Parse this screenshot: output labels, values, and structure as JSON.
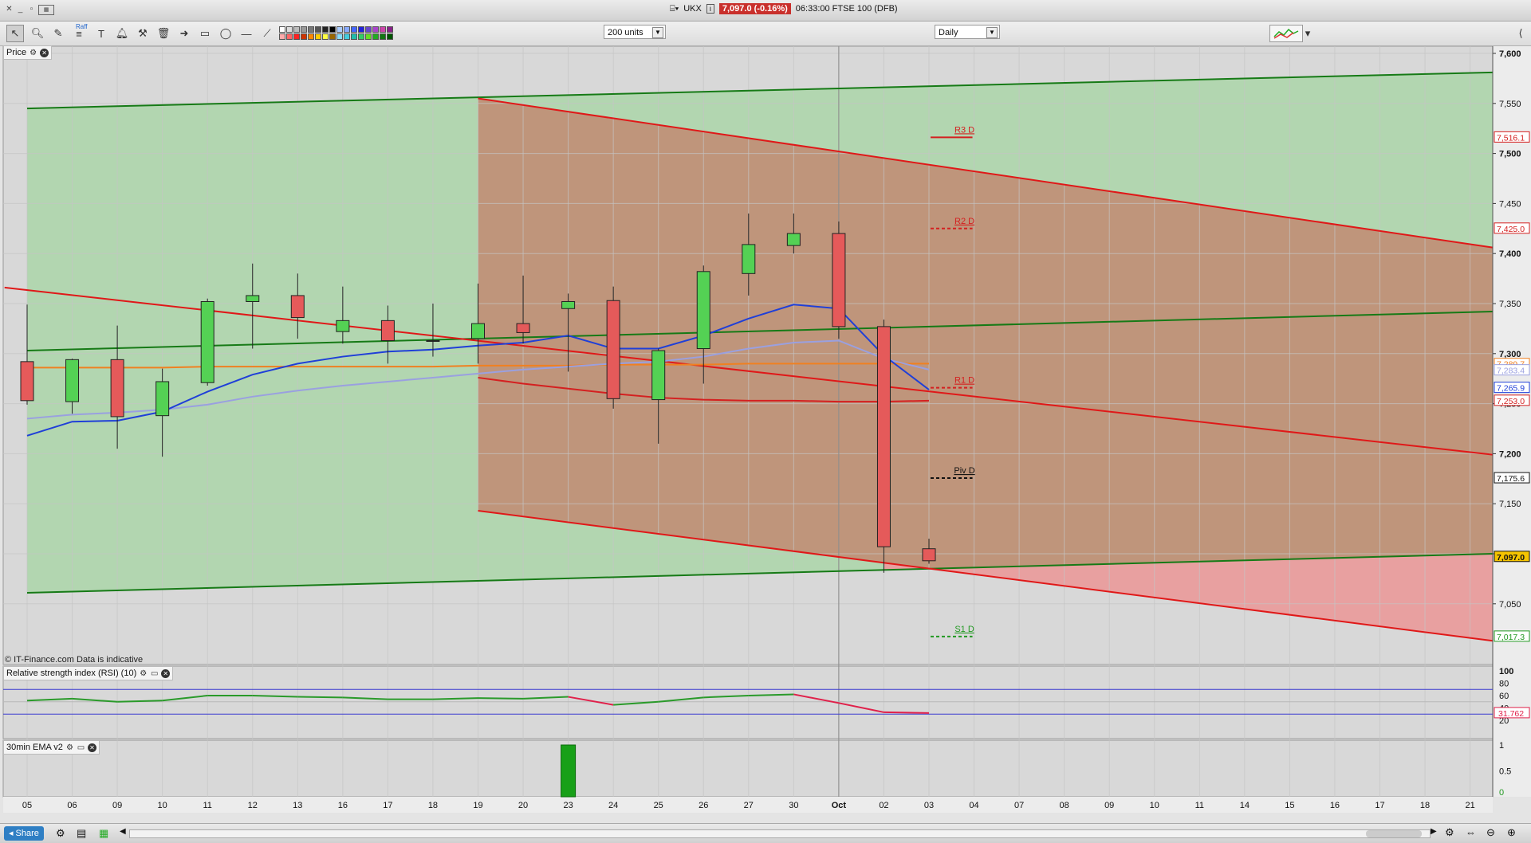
{
  "window": {
    "title_icon": "briefcase-icon",
    "symbol": "UKX",
    "info_icon": "info-icon",
    "last_price": "7,097.0 (-0.16%)",
    "time_instrument": "06:33:00 FTSE 100 (DFB)"
  },
  "toolbar": {
    "units": "200 units",
    "interval": "Daily",
    "fib_label": "Raff"
  },
  "panels": {
    "price": {
      "label": "Price"
    },
    "rsi": {
      "label": "Relative strength index (RSI) (10)"
    },
    "ema": {
      "label": "30min EMA v2"
    }
  },
  "copyright": "© IT-Finance.com  Data is indicative",
  "price_axis": {
    "ticks": [
      "7,600",
      "7,550",
      "7,500",
      "7,450",
      "7,400",
      "7,350",
      "7,300",
      "7,250",
      "7,200",
      "7,150",
      "7,100",
      "7,050"
    ],
    "tick_values": [
      7600,
      7550,
      7500,
      7450,
      7400,
      7350,
      7300,
      7250,
      7200,
      7150,
      7100,
      7050
    ],
    "tags": [
      {
        "text": "7,516.1",
        "value": 7516.1,
        "bg": "#ffffff",
        "fg": "#d42020"
      },
      {
        "text": "7,425.0",
        "value": 7425.0,
        "bg": "#ffffff",
        "fg": "#d42020"
      },
      {
        "text": "7,289.7",
        "value": 7289.7,
        "bg": "#ffffff",
        "fg": "#f08020"
      },
      {
        "text": "7,283.4",
        "value": 7283.4,
        "bg": "#ffffff",
        "fg": "#9aa0e0"
      },
      {
        "text": "7,265.9",
        "value": 7265.9,
        "bg": "#ffffff",
        "fg": "#1f3fd8"
      },
      {
        "text": "7,253.0",
        "value": 7253.0,
        "bg": "#ffffff",
        "fg": "#d42020"
      },
      {
        "text": "7,175.6",
        "value": 7175.6,
        "bg": "#ffffff",
        "fg": "#111111"
      },
      {
        "text": "7,097.0",
        "value": 7097.0,
        "bg": "#f5c400",
        "fg": "#111111"
      },
      {
        "text": "7,017.3",
        "value": 7017.3,
        "bg": "#ffffff",
        "fg": "#229922"
      }
    ]
  },
  "pivots": [
    {
      "label": "R3 D",
      "value": 7516.1,
      "color": "#d42020",
      "dashed": false
    },
    {
      "label": "R2 D",
      "value": 7425.0,
      "color": "#d42020",
      "dashed": true
    },
    {
      "label": "R1 D",
      "value": 7265.9,
      "color": "#d42020",
      "dashed": true
    },
    {
      "label": "Piv D",
      "value": 7175.6,
      "color": "#111111",
      "dashed": true
    },
    {
      "label": "S1 D",
      "value": 7017.3,
      "color": "#229922",
      "dashed": true
    }
  ],
  "rsi_axis": {
    "ticks": [
      "100",
      "80",
      "60",
      "40",
      "20"
    ],
    "tick_values": [
      100,
      80,
      60,
      40,
      20
    ],
    "value_tag": "31.762",
    "value": 31.762
  },
  "ema_axis": {
    "ticks": [
      "1",
      "0.5",
      "0"
    ],
    "tick_values": [
      1,
      0.5,
      0
    ]
  },
  "chart_data": {
    "type": "candlestick",
    "title": "",
    "dates": [
      "05",
      "06",
      "09",
      "10",
      "11",
      "12",
      "13",
      "16",
      "17",
      "18",
      "19",
      "20",
      "23",
      "24",
      "25",
      "26",
      "27",
      "30",
      "Oct",
      "02",
      "03",
      "04",
      "07",
      "08",
      "09",
      "10",
      "11",
      "14",
      "15",
      "16",
      "17",
      "18",
      "21"
    ],
    "candles": [
      {
        "date": "05",
        "open": 7292,
        "high": 7349,
        "low": 7249,
        "close": 7253
      },
      {
        "date": "06",
        "open": 7252,
        "high": 7295,
        "low": 7240,
        "close": 7294
      },
      {
        "date": "09",
        "open": 7294,
        "high": 7328,
        "low": 7205,
        "close": 7237
      },
      {
        "date": "10",
        "open": 7238,
        "high": 7285,
        "low": 7197,
        "close": 7272
      },
      {
        "date": "11",
        "open": 7271,
        "high": 7355,
        "low": 7268,
        "close": 7352
      },
      {
        "date": "12",
        "open": 7352,
        "high": 7390,
        "low": 7305,
        "close": 7358
      },
      {
        "date": "13",
        "open": 7358,
        "high": 7380,
        "low": 7315,
        "close": 7336
      },
      {
        "date": "16",
        "open": 7322,
        "high": 7367,
        "low": 7310,
        "close": 7333
      },
      {
        "date": "17",
        "open": 7333,
        "high": 7348,
        "low": 7290,
        "close": 7313
      },
      {
        "date": "18",
        "open": 7313,
        "high": 7350,
        "low": 7297,
        "close": 7313
      },
      {
        "date": "19",
        "open": 7315,
        "high": 7370,
        "low": 7290,
        "close": 7330
      },
      {
        "date": "20",
        "open": 7330,
        "high": 7378,
        "low": 7310,
        "close": 7321
      },
      {
        "date": "23",
        "open": 7345,
        "high": 7360,
        "low": 7282,
        "close": 7352
      },
      {
        "date": "24",
        "open": 7353,
        "high": 7367,
        "low": 7245,
        "close": 7255
      },
      {
        "date": "25",
        "open": 7254,
        "high": 7305,
        "low": 7210,
        "close": 7303
      },
      {
        "date": "26",
        "open": 7305,
        "high": 7388,
        "low": 7270,
        "close": 7382
      },
      {
        "date": "27",
        "open": 7380,
        "high": 7440,
        "low": 7358,
        "close": 7409
      },
      {
        "date": "30",
        "open": 7408,
        "high": 7440,
        "low": 7400,
        "close": 7420
      },
      {
        "date": "Oct",
        "open": 7420,
        "high": 7432,
        "low": 7315,
        "close": 7327
      },
      {
        "date": "02",
        "open": 7327,
        "high": 7334,
        "low": 7081,
        "close": 7107
      },
      {
        "date": "03",
        "open": 7105,
        "high": 7115,
        "low": 7090,
        "close": 7093
      }
    ],
    "ma_fast": {
      "color": "#1f3fd8",
      "values": [
        7218,
        7232,
        7233,
        7242,
        7262,
        7279,
        7290,
        7297,
        7302,
        7304,
        7308,
        7311,
        7318,
        7305,
        7305,
        7318,
        7335,
        7349,
        7345,
        7298,
        7264
      ]
    },
    "ma_mid": {
      "color": "#9aa0e0",
      "values": [
        7235,
        7239,
        7241,
        7244,
        7249,
        7257,
        7263,
        7268,
        7272,
        7276,
        7280,
        7284,
        7287,
        7290,
        7292,
        7297,
        7305,
        7311,
        7313,
        7295,
        7284
      ]
    },
    "ma_slow": {
      "color": "#f08020",
      "values": [
        7286,
        7286,
        7286,
        7286,
        7287,
        7287,
        7287,
        7287,
        7287,
        7287,
        7288,
        7288,
        7288,
        7289,
        7289,
        7289,
        7290,
        7290,
        7290,
        7290,
        7290
      ]
    },
    "ma_red": {
      "color": "#d42020",
      "from_index": 10,
      "values": [
        7276,
        7270,
        7265,
        7260,
        7256,
        7254,
        7253,
        7253,
        7252,
        7252,
        7253
      ]
    },
    "channels": {
      "green": {
        "start_index": 0,
        "end_date_offset": 32.5,
        "upper": [
          7545,
          7581
        ],
        "mid": [
          7303,
          7342
        ],
        "lower": [
          7061,
          7100
        ]
      },
      "red": {
        "start_index": 10,
        "upper_start": 7555,
        "upper_end": 7406,
        "lower_start": 7143,
        "lower_end": 7013
      },
      "red_trend": {
        "start": [
          -0.5,
          7366
        ],
        "end": [
          32.5,
          7199
        ]
      }
    },
    "rsi": [
      52,
      55,
      50,
      52,
      60,
      60,
      58,
      57,
      54,
      54,
      56,
      55,
      58,
      45,
      50,
      57,
      60,
      62,
      48,
      33,
      31.762
    ],
    "ema_signal": {
      "date": "23",
      "value": 1
    }
  },
  "statusbar": {
    "share_label": "Share"
  },
  "colors": {
    "green_fill": "#b2d6b0",
    "brown_fill": "#c08e75",
    "red_fill": "#e8a0a0",
    "bull": "#54d154",
    "bear": "#e55a5a"
  }
}
